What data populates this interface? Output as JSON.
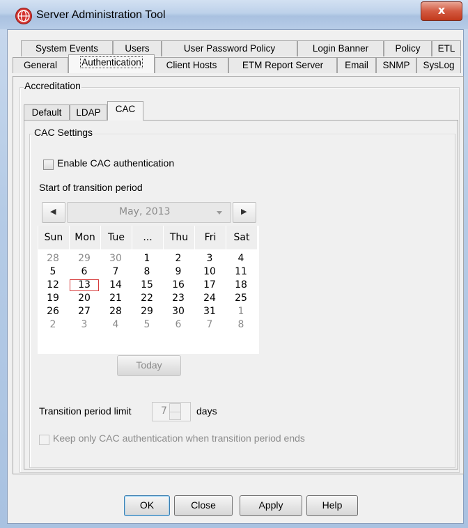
{
  "window": {
    "title": "Server Administration Tool",
    "close_glyph": "x"
  },
  "tabs_row1": [
    "System Events",
    "Users",
    "User Password Policy",
    "Login Banner",
    "Policy",
    "ETL"
  ],
  "tabs_row2": [
    "General",
    "Authentication",
    "Client Hosts",
    "ETM Report Server",
    "Email",
    "SNMP",
    "SysLog"
  ],
  "selected_tab": "Authentication",
  "accreditation": {
    "title": "Accreditation",
    "subtabs": [
      "Default",
      "LDAP",
      "CAC"
    ],
    "selected_subtab": "CAC"
  },
  "cac": {
    "group_title": "CAC Settings",
    "enable_label": "Enable CAC authentication",
    "enable_checked": false,
    "transition_start_label": "Start of transition period",
    "calendar": {
      "month_label": "May, 2013",
      "prev_glyph": "◀",
      "next_glyph": "▶",
      "weekdays": [
        "Sun",
        "Mon",
        "Tue",
        "...",
        "Thu",
        "Fri",
        "Sat"
      ],
      "weeks": [
        [
          "28",
          "29",
          "30",
          "1",
          "2",
          "3",
          "4"
        ],
        [
          "5",
          "6",
          "7",
          "8",
          "9",
          "10",
          "11"
        ],
        [
          "12",
          "13",
          "14",
          "15",
          "16",
          "17",
          "18"
        ],
        [
          "19",
          "20",
          "21",
          "22",
          "23",
          "24",
          "25"
        ],
        [
          "26",
          "27",
          "28",
          "29",
          "30",
          "31",
          "1"
        ],
        [
          "2",
          "3",
          "4",
          "5",
          "6",
          "7",
          "8"
        ]
      ],
      "selected_day": "13",
      "today_button": "Today"
    },
    "limit_label": "Transition period limit",
    "limit_value": "7",
    "limit_unit": "days",
    "keep_only_label": "Keep only CAC authentication when transition period ends",
    "keep_only_checked": false
  },
  "buttons": {
    "ok": "OK",
    "close": "Close",
    "apply": "Apply",
    "help": "Help"
  },
  "colors": {
    "today_outline": "#d63a3a",
    "default_button_border": "#3c7fb1"
  }
}
